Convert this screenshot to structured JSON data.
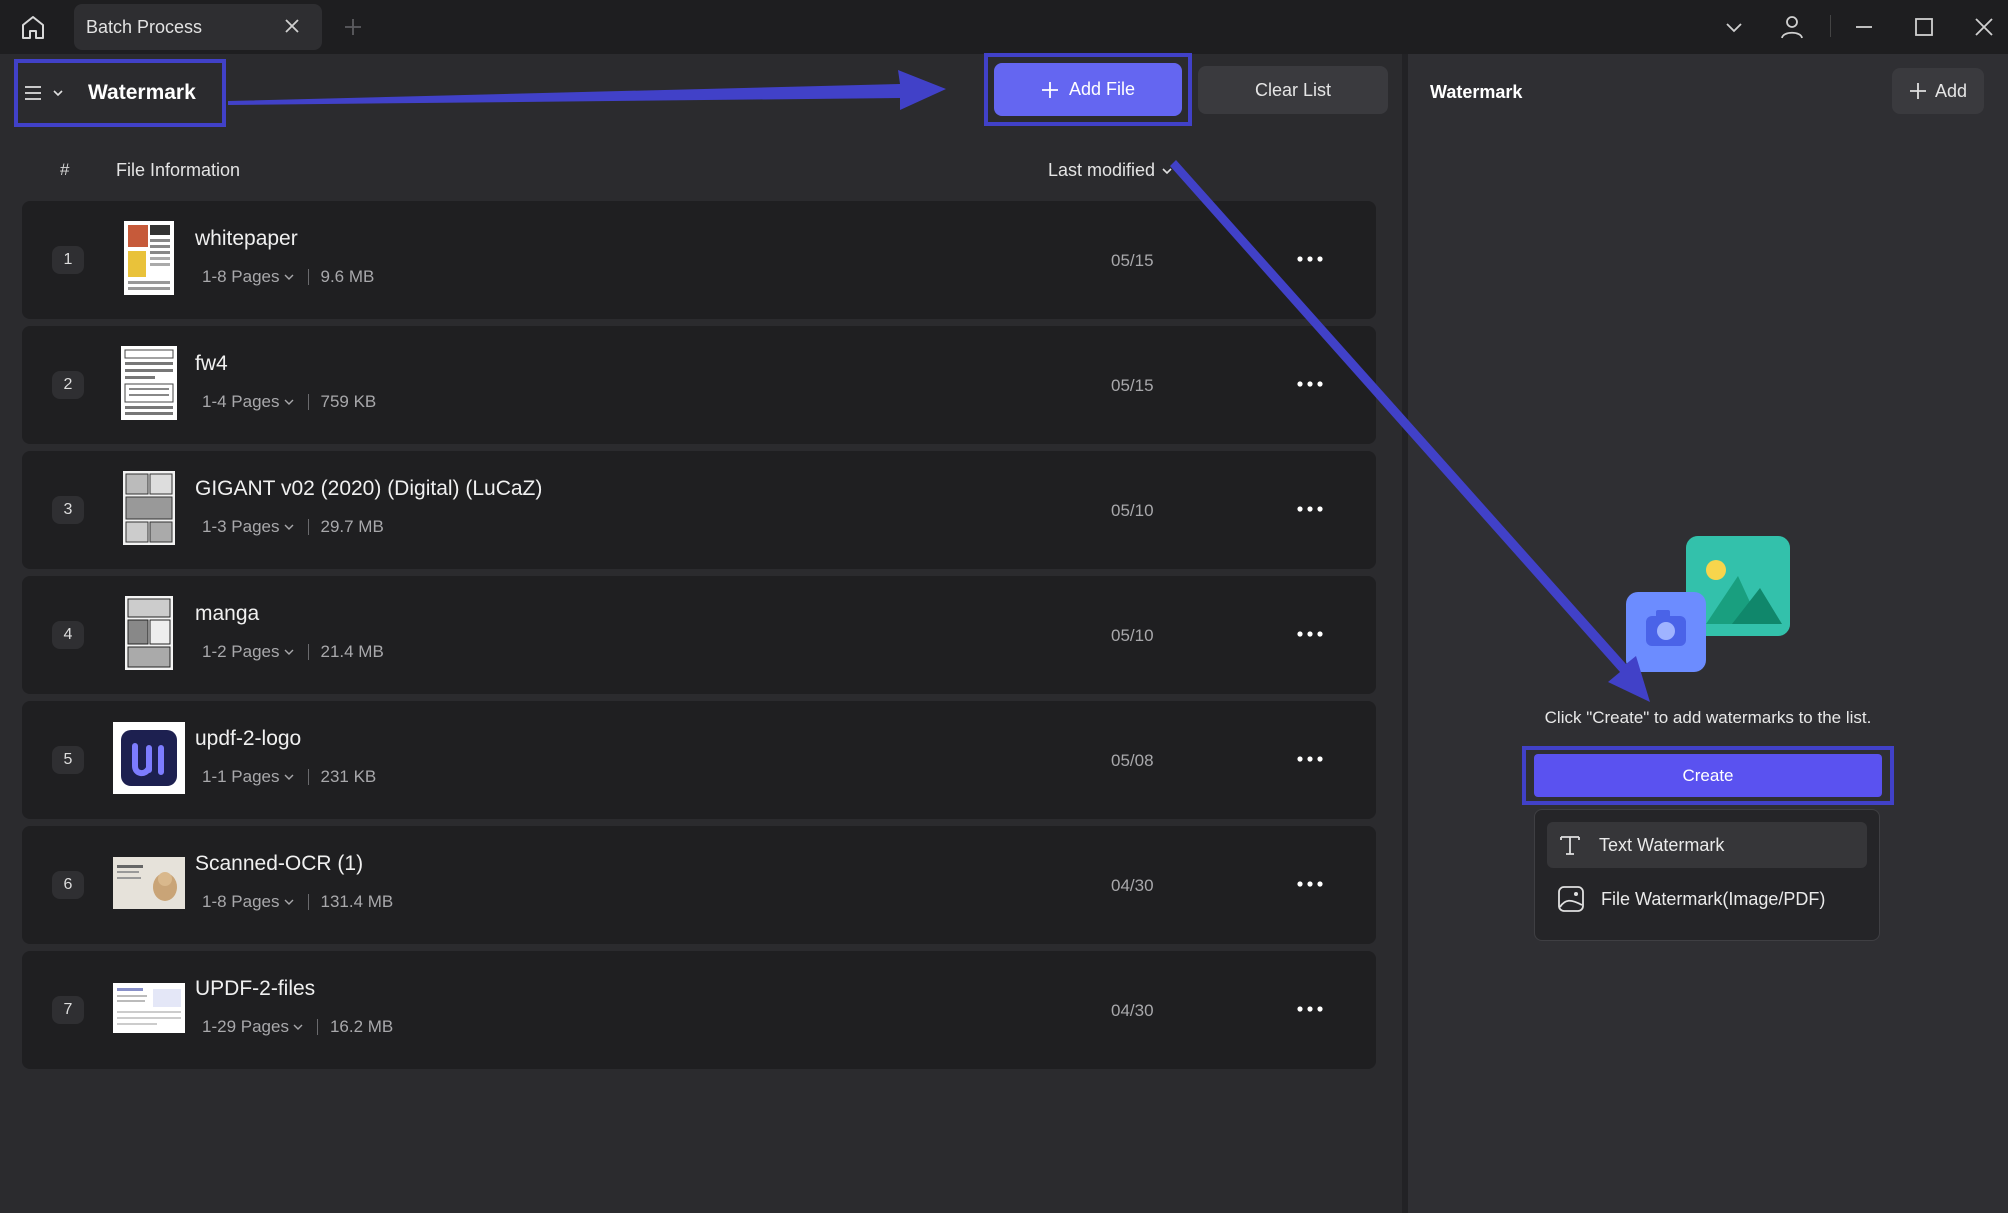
{
  "titlebar": {
    "home_icon": "home-icon",
    "tab_label": "Batch Process",
    "close_icon": "close-icon",
    "new_tab_icon": "plus-icon"
  },
  "toolbar": {
    "mode_label": "Watermark",
    "add_file_label": "Add File",
    "clear_list_label": "Clear List"
  },
  "columns": {
    "hash": "#",
    "file_info": "File Information",
    "last_modified": "Last modified"
  },
  "files": [
    {
      "index": "1",
      "name": "whitepaper",
      "pages": "1-8 Pages",
      "size": "9.6 MB",
      "date": "05/15"
    },
    {
      "index": "2",
      "name": "fw4",
      "pages": "1-4 Pages",
      "size": "759 KB",
      "date": "05/15"
    },
    {
      "index": "3",
      "name": "GIGANT v02 (2020) (Digital) (LuCaZ)",
      "pages": "1-3 Pages",
      "size": "29.7 MB",
      "date": "05/10"
    },
    {
      "index": "4",
      "name": "manga",
      "pages": "1-2 Pages",
      "size": "21.4 MB",
      "date": "05/10"
    },
    {
      "index": "5",
      "name": "updf-2-logo",
      "pages": "1-1 Pages",
      "size": "231 KB",
      "date": "05/08"
    },
    {
      "index": "6",
      "name": "Scanned-OCR (1)",
      "pages": "1-8 Pages",
      "size": "131.4 MB",
      "date": "04/30"
    },
    {
      "index": "7",
      "name": "UPDF-2-files",
      "pages": "1-29 Pages",
      "size": "16.2 MB",
      "date": "04/30"
    }
  ],
  "right_panel": {
    "title": "Watermark",
    "add_label": "Add",
    "hint": "Click \"Create\" to add watermarks to the list.",
    "create_label": "Create",
    "menu": {
      "text_watermark": "Text Watermark",
      "file_watermark": "File Watermark(Image/PDF)"
    }
  },
  "colors": {
    "accent": "#6466f1",
    "annotation": "#4141c8",
    "background": "#2b2b2e",
    "row": "#1f1f21"
  }
}
